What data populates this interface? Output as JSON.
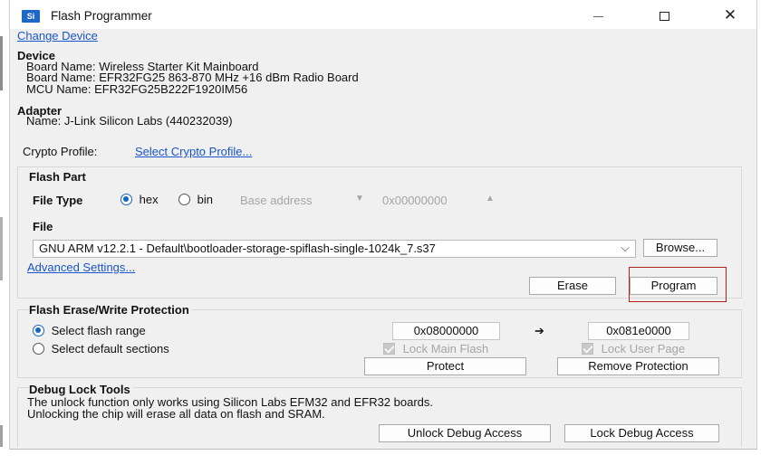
{
  "window": {
    "title": "Flash Programmer",
    "app_icon_text": "Si",
    "close_glyph": "✕"
  },
  "change_device_link": "Change Device",
  "device": {
    "heading": "Device",
    "board_name_1": "Board Name: Wireless Starter Kit Mainboard",
    "board_name_2": "Board Name: EFR32FG25 863-870 MHz +16 dBm Radio Board",
    "mcu_name": "MCU Name: EFR32FG25B222F1920IM56"
  },
  "adapter": {
    "heading": "Adapter",
    "name": "Name: J-Link Silicon Labs (440232039)"
  },
  "crypto": {
    "label": "Crypto Profile:",
    "link": "Select Crypto Profile..."
  },
  "flash_part": {
    "heading": "Flash Part",
    "file_type_label": "File Type",
    "hex_label": "hex",
    "bin_label": "bin",
    "hex_selected": true,
    "base_address_label": "Base address",
    "base_address_value": "0x00000000",
    "down_arrow": "▼",
    "up_arrow": "▲",
    "file_label": "File",
    "file_path": "GNU ARM v12.2.1 - Default\\bootloader-storage-spiflash-single-1024k_7.s37",
    "dropdown_chevron": "⌵",
    "browse_label": "Browse...",
    "advanced_settings_link": "Advanced Settings...",
    "erase_label": "Erase",
    "program_label": "Program"
  },
  "protection": {
    "heading": "Flash Erase/Write Protection",
    "select_range_label": "Select flash range",
    "select_default_label": "Select default sections",
    "range_start": "0x08000000",
    "arrow": "➔",
    "range_end": "0x081e0000",
    "lock_main_flash": "Lock Main Flash",
    "lock_user_page": "Lock User Page",
    "protect_label": "Protect",
    "remove_protection_label": "Remove Protection"
  },
  "debug_lock": {
    "heading": "Debug Lock Tools",
    "line_1": "The unlock function only works using Silicon Labs EFM32 and EFR32 boards.",
    "line_2": "Unlocking the chip will erase all data on flash and SRAM.",
    "unlock_label": "Unlock Debug Access",
    "lock_label": "Lock Debug Access"
  },
  "colors": {
    "link": "#1a55c9",
    "radio_selected": "#1565c0",
    "highlight_border": "#b32020"
  }
}
